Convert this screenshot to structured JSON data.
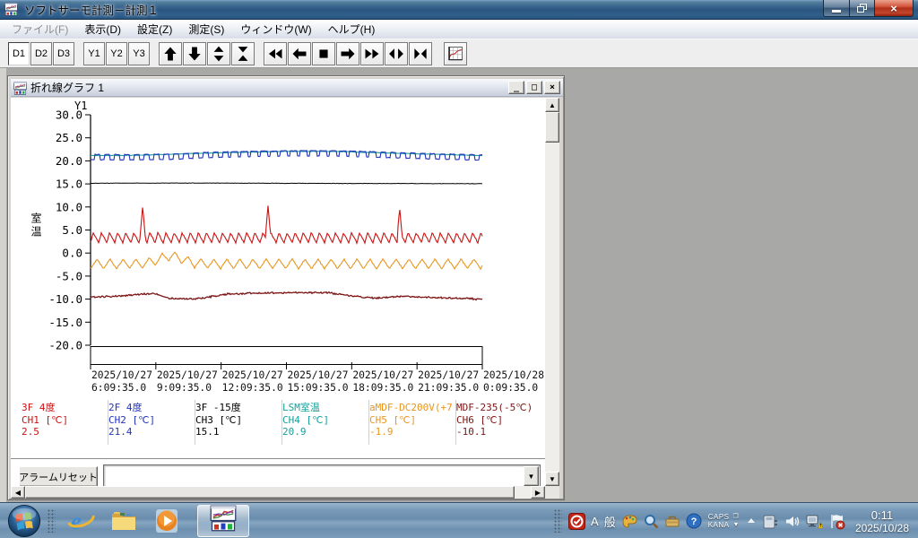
{
  "app": {
    "title": "ソフトサーモ計測－計測１"
  },
  "menu": {
    "items": [
      {
        "label": "ファイル(F)",
        "enabled": false
      },
      {
        "label": "表示(D)",
        "enabled": true
      },
      {
        "label": "設定(Z)",
        "enabled": true
      },
      {
        "label": "測定(S)",
        "enabled": true
      },
      {
        "label": "ウィンドウ(W)",
        "enabled": true
      },
      {
        "label": "ヘルプ(H)",
        "enabled": true
      }
    ]
  },
  "toolbar": {
    "d_buttons": [
      {
        "label": "D1",
        "active": true
      },
      {
        "label": "D2",
        "active": false
      },
      {
        "label": "D3",
        "active": false
      }
    ],
    "y_buttons": [
      {
        "label": "Y1",
        "active": false
      },
      {
        "label": "Y2",
        "active": false
      },
      {
        "label": "Y3",
        "active": false
      }
    ],
    "nav_icons": [
      "arrow-up",
      "arrow-down",
      "expand-vertical",
      "collapse-vertical"
    ],
    "transport_icons": [
      "skip-back",
      "step-back",
      "stop",
      "step-forward",
      "skip-forward",
      "expand-horizontal",
      "collapse-horizontal"
    ],
    "extra_icons": [
      "graph-settings"
    ]
  },
  "graph_window": {
    "title": "折れ線グラフ 1",
    "alarm_reset_label": "アラームリセット",
    "combo_value": ""
  },
  "chart_data": {
    "type": "line",
    "axis_name": "Y1",
    "ylabel": "室温",
    "ylim": [
      -20,
      30
    ],
    "grid": false,
    "y_ticks": [
      "30.0",
      "25.0",
      "20.0",
      "15.0",
      "10.0",
      "5.0",
      "0.0",
      "-5.0",
      "-10.0",
      "-15.0",
      "-20.0"
    ],
    "x_ticks": [
      {
        "date": "2025/10/27",
        "time": "6:09:35.0"
      },
      {
        "date": "2025/10/27",
        "time": "9:09:35.0"
      },
      {
        "date": "2025/10/27",
        "time": "12:09:35.0"
      },
      {
        "date": "2025/10/27",
        "time": "15:09:35.0"
      },
      {
        "date": "2025/10/27",
        "time": "18:09:35.0"
      },
      {
        "date": "2025/10/27",
        "time": "21:09:35.0"
      },
      {
        "date": "2025/10/28",
        "time": "0:09:35.0"
      }
    ],
    "series": [
      {
        "name": "3F 4度",
        "channel": "CH1",
        "unit": "[℃]",
        "value": "2.5",
        "color": "#cc1111",
        "waveform": {
          "kind": "sawtooth",
          "period": 9,
          "low": 2.25,
          "high": 4.4,
          "duty": 0.35,
          "noise": 0.1,
          "spikes": [
            {
              "t": 0.133,
              "value": 10.2
            },
            {
              "t": 0.453,
              "value": 10.3
            },
            {
              "t": 0.789,
              "value": 9.9
            }
          ]
        }
      },
      {
        "name": "2F 4度",
        "channel": "CH2",
        "unit": "[℃]",
        "value": "21.4",
        "color": "#2233bb",
        "waveform": {
          "kind": "square-dip",
          "dip_period": 11,
          "dip_width": 5,
          "dip_width_mid": 2.5,
          "mid_range": [
            0.34,
            0.72
          ],
          "dip_depth": 1.15,
          "noise": 0.05,
          "envelope": [
            [
              0,
              21.4
            ],
            [
              0.1,
              21.35
            ],
            [
              0.22,
              21.5
            ],
            [
              0.3,
              21.85
            ],
            [
              0.42,
              22.1
            ],
            [
              0.55,
              22.2
            ],
            [
              0.65,
              22.15
            ],
            [
              0.78,
              21.8
            ],
            [
              0.9,
              21.5
            ],
            [
              1,
              21.3
            ]
          ]
        }
      },
      {
        "name": "3F -15度",
        "channel": "CH3",
        "unit": "[℃]",
        "value": "15.1",
        "color": "#000000",
        "waveform": {
          "kind": "envelope",
          "noise": 0.04,
          "envelope": [
            [
              0,
              15.15
            ],
            [
              0.3,
              15.18
            ],
            [
              0.55,
              15.12
            ],
            [
              1,
              15.05
            ]
          ]
        }
      },
      {
        "name": "LSM室温",
        "channel": "CH4",
        "unit": "[℃]",
        "value": "20.9",
        "color": "#17a099",
        "waveform": {
          "kind": "envelope",
          "noise": 0.05,
          "envelope": [
            [
              0,
              21.15
            ],
            [
              0.12,
              21.2
            ],
            [
              0.3,
              21.7
            ],
            [
              0.5,
              22.05
            ],
            [
              0.62,
              22.05
            ],
            [
              0.8,
              21.6
            ],
            [
              1,
              21.15
            ]
          ]
        }
      },
      {
        "name": "aMDF-DC200V(+7",
        "channel": "CH5",
        "unit": "[℃]",
        "value": "-1.9",
        "color": "#e8951e",
        "waveform": {
          "kind": "zigzag",
          "period": 14.5,
          "center": -2.35,
          "amp": 1.05,
          "noise": 0.1,
          "bump": {
            "t": 0.205,
            "sigma": 0.03,
            "height": 1.7
          }
        }
      },
      {
        "name": "MDF-235(-5℃)",
        "channel": "CH6",
        "unit": "[℃]",
        "value": "-10.1",
        "color": "#7c1414",
        "waveform": {
          "kind": "envelope",
          "noise": 0.14,
          "envelope": [
            [
              0,
              -9.55
            ],
            [
              0.04,
              -9.45
            ],
            [
              0.09,
              -9.2
            ],
            [
              0.13,
              -8.9
            ],
            [
              0.16,
              -8.75
            ],
            [
              0.175,
              -9.1
            ],
            [
              0.2,
              -9.85
            ],
            [
              0.24,
              -10.0
            ],
            [
              0.28,
              -9.9
            ],
            [
              0.31,
              -9.4
            ],
            [
              0.35,
              -8.9
            ],
            [
              0.4,
              -8.75
            ],
            [
              0.47,
              -8.65
            ],
            [
              0.54,
              -8.55
            ],
            [
              0.6,
              -8.6
            ],
            [
              0.64,
              -8.9
            ],
            [
              0.67,
              -9.4
            ],
            [
              0.71,
              -9.7
            ],
            [
              0.74,
              -9.8
            ],
            [
              0.77,
              -9.55
            ],
            [
              0.8,
              -9.3
            ],
            [
              0.82,
              -9.45
            ],
            [
              0.86,
              -9.65
            ],
            [
              0.9,
              -9.75
            ],
            [
              0.95,
              -9.85
            ],
            [
              1,
              -10.05
            ]
          ]
        }
      }
    ]
  },
  "taskbar": {
    "clock": {
      "time": "0:11",
      "date": "2025/10/28"
    },
    "ime": {
      "mode": "A",
      "conv": "般",
      "caps": "CAPS",
      "kana": "KANA"
    }
  },
  "colors": {
    "titlebar_blue": "#2a5580",
    "close_red": "#b0301b",
    "mdi_gray": "#a8a8a6"
  }
}
